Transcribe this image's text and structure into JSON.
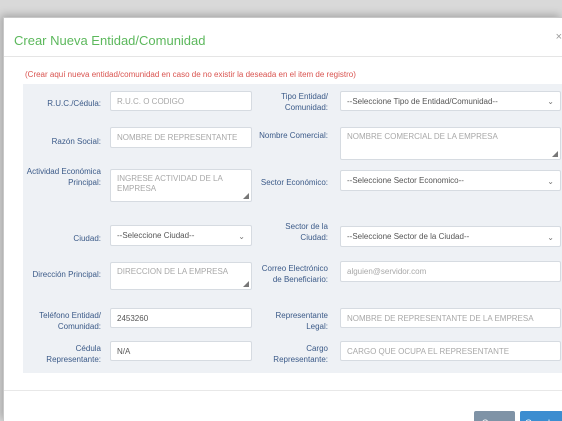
{
  "modal": {
    "title": "Crear Nueva Entidad/Comunidad",
    "close_glyph": "×",
    "notice": "(Crear aquí nueva entidad/comunidad en caso de no existir la deseada en el item de registro)"
  },
  "form": {
    "ruc": {
      "label": "R.U.C./Cédula:",
      "placeholder": "R.U.C. O CODIGO"
    },
    "tipo_entidad": {
      "label": "Tipo Entidad/ Comunidad:",
      "selected": "--Seleccione Tipo de Entidad/Comunidad--"
    },
    "razon_social": {
      "label": "Razón Social:",
      "placeholder": "NOMBRE DE REPRESENTANTE"
    },
    "nombre_comercial": {
      "label": "Nombre Comercial:",
      "placeholder": "NOMBRE COMERCIAL DE LA EMPRESA"
    },
    "actividad": {
      "label": "Actividad Económica Principal:",
      "placeholder": "INGRESE ACTIVIDAD DE LA EMPRESA"
    },
    "sector_economico": {
      "label": "Sector Económico:",
      "selected": "--Seleccione Sector Economico--"
    },
    "ciudad": {
      "label": "Ciudad:",
      "selected": "--Seleccione Ciudad--"
    },
    "sector_ciudad": {
      "label": "Sector de la Ciudad:",
      "selected": "--Seleccione Sector de la Ciudad--"
    },
    "direccion": {
      "label": "Dirección Principal:",
      "placeholder": "DIRECCION DE LA EMPRESA"
    },
    "correo": {
      "label": "Correo Electrónico de Beneficiario:",
      "placeholder": "alguien@servidor.com"
    },
    "telefono": {
      "label": "Teléfono Entidad/ Comunidad:",
      "value": "2453260"
    },
    "representante": {
      "label": "Representante Legal:",
      "placeholder": "NOMBRE DE REPRESENTANTE DE LA EMPRESA"
    },
    "cedula": {
      "label": "Cédula Representante:",
      "value": "N/A"
    },
    "cargo": {
      "label": "Cargo Representante:",
      "placeholder": "CARGO QUE OCUPA EL REPRESENTANTE"
    }
  },
  "footer": {
    "close_label": "Cerrar",
    "save_label": "Guardar"
  },
  "colors": {
    "title": "#5cb85c",
    "notice": "#d9534f",
    "label": "#3b5a88",
    "close_button": "#7f93a6",
    "save_button": "#3c8dd0"
  }
}
